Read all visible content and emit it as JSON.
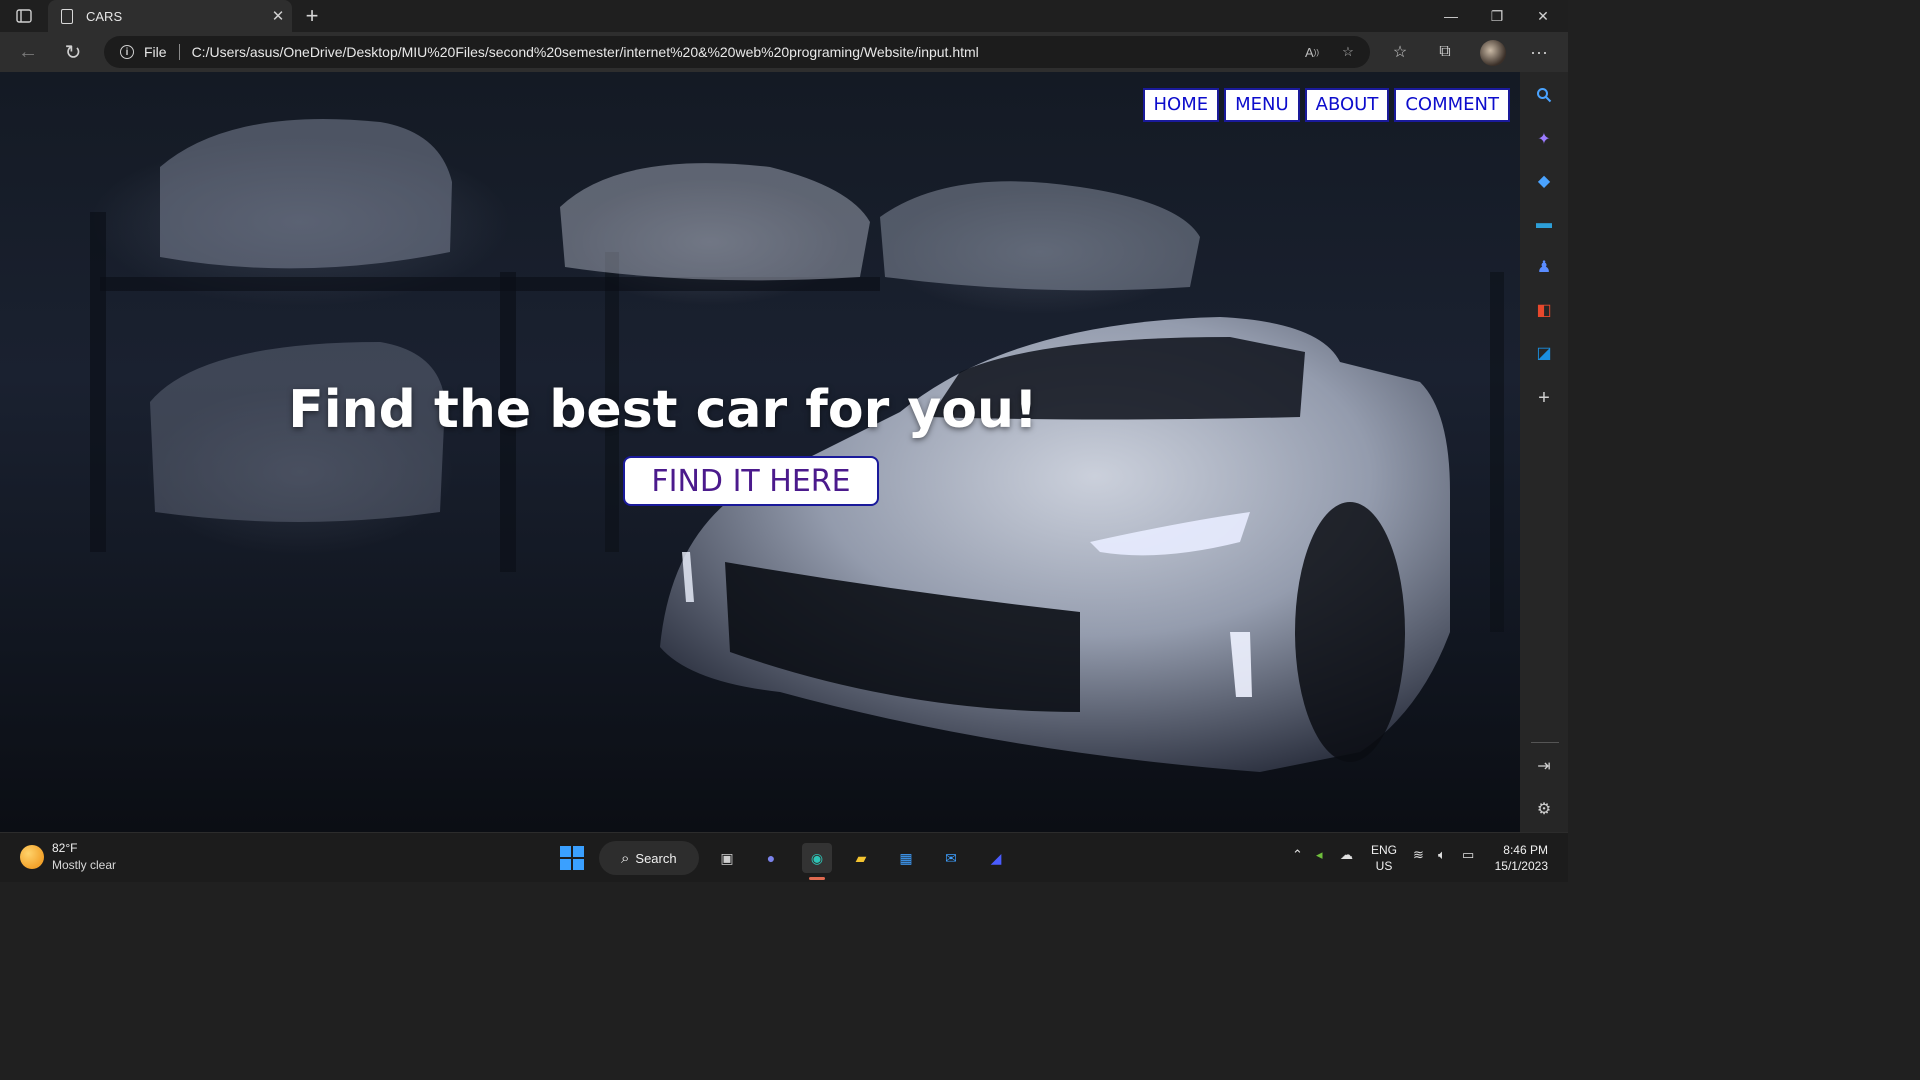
{
  "browser": {
    "tab_title": "CARS",
    "scheme_label": "File",
    "url": "C:/Users/asus/OneDrive/Desktop/MIU%20Files/second%20semester/internet%20&%20web%20programing/Website/input.html"
  },
  "page": {
    "nav": [
      "HOME",
      "MENU",
      "ABOUT",
      "COMMENT"
    ],
    "hero_title": "Find the best car for you!",
    "cta_label": "FIND IT HERE",
    "colors": {
      "nav_text": "#0d0dcc",
      "cta_text": "#4b1a8c",
      "border": "#1a1a9a"
    }
  },
  "taskbar": {
    "weather_temp": "82°F",
    "weather_condition": "Mostly clear",
    "search_label": "Search",
    "lang_line1": "ENG",
    "lang_line2": "US",
    "time": "8:46 PM",
    "date": "15/1/2023"
  }
}
